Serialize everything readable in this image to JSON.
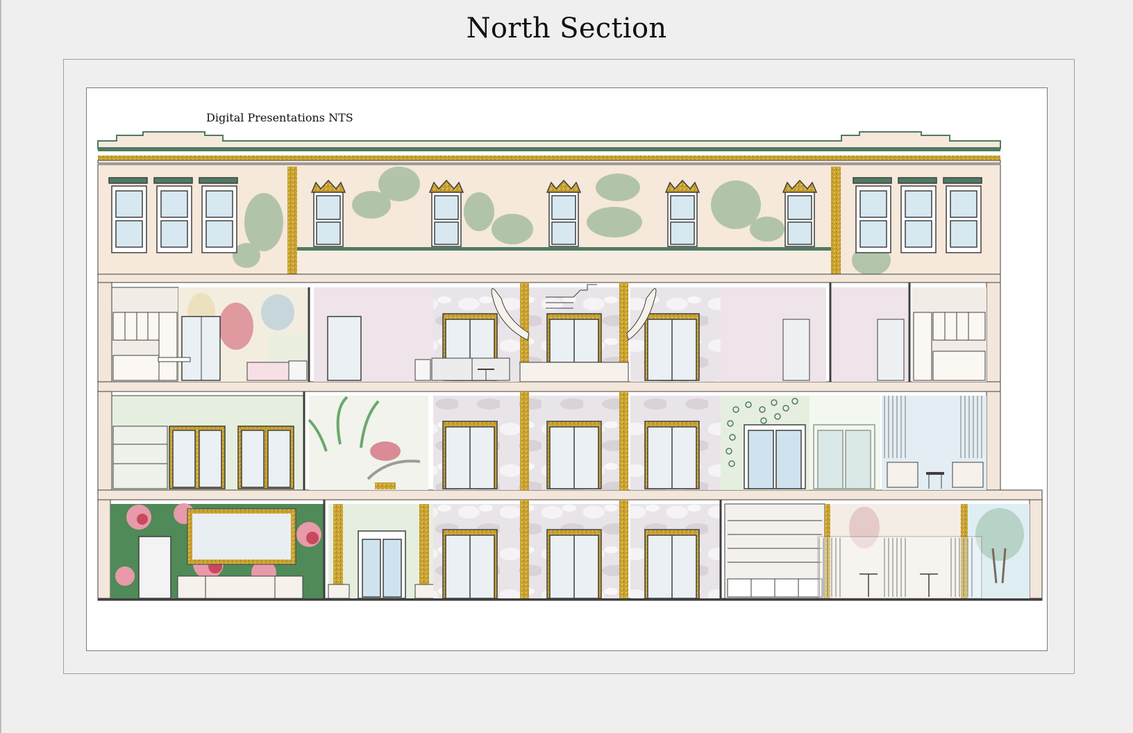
{
  "page": {
    "title": "North Section"
  },
  "sheet": {
    "caption": "Digital Presentations NTS"
  },
  "colors": {
    "wall": "#f6e8da",
    "gold": "#c9a230",
    "trim": "#4f7a63",
    "glass": "#d7e8f0",
    "foliage": "#7aa883",
    "line": "#3f3f3f",
    "blush": "#eee4ea",
    "mint": "#e6efdf",
    "floral": "#c9485e"
  }
}
